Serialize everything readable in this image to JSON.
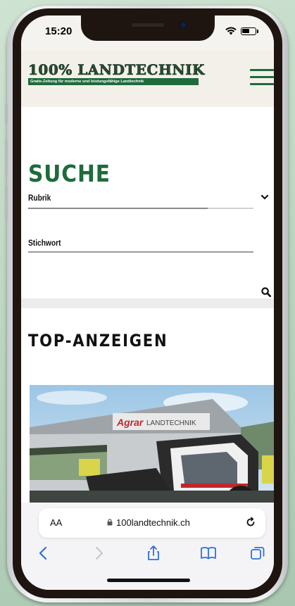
{
  "status_bar": {
    "time": "15:20"
  },
  "header": {
    "logo_title": "100% LANDTECHNIK",
    "logo_tagline": "Gratis-Zeitung für moderne und leistungsfähige Landtechnik"
  },
  "search": {
    "title": "SUCHE",
    "rubrik_label": "Rubrik",
    "stichwort_label": "Stichwort"
  },
  "top_ads": {
    "title": "TOP-ANZEIGEN",
    "image_sign_text": "Agrar LANDTECHNIK"
  },
  "browser": {
    "aa_label": "AA",
    "url": "100landtechnik.ch"
  },
  "colors": {
    "brand_green": "#1e6b3c",
    "bezel": "#1e1410"
  },
  "icons": [
    "wifi-icon",
    "battery-icon",
    "menu-icon",
    "chevron-down-icon",
    "search-icon",
    "lock-icon",
    "reload-icon",
    "back-icon",
    "forward-icon",
    "share-icon",
    "bookmarks-icon",
    "tabs-icon"
  ]
}
